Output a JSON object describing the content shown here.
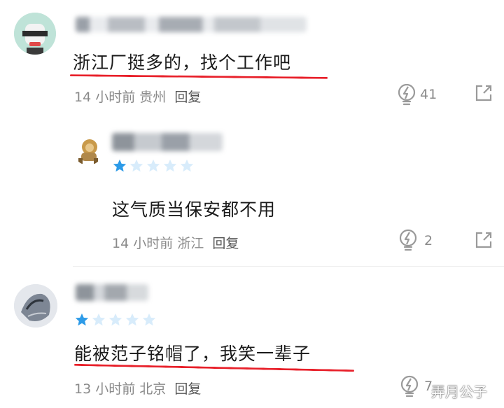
{
  "comments": [
    {
      "text": "浙江厂挺多的，找个工作吧",
      "time": "14 小时前",
      "location": "贵州",
      "reply_label": "回复",
      "likes": "41",
      "stars": null
    },
    {
      "text": "这气质当保安都不用",
      "time": "14 小时前",
      "location": "浙江",
      "reply_label": "回复",
      "likes": "2",
      "stars": 1
    },
    {
      "text": "能被范子铭帽了，我笑一辈子",
      "time": "13 小时前",
      "location": "北京",
      "reply_label": "回复",
      "likes": "7",
      "stars": 1
    }
  ],
  "watermark": "弄月公子",
  "colors": {
    "underline": "#e8202a",
    "star_filled": "#2d9be8",
    "star_empty": "#d8ecfb",
    "meta_text": "#8a8a8a"
  },
  "icons": [
    "like-bulb-icon",
    "share-icon"
  ]
}
